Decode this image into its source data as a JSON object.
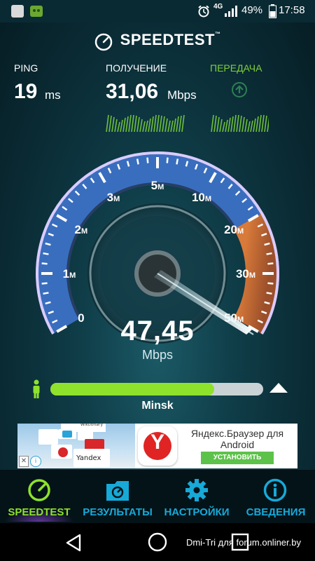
{
  "status_bar": {
    "left_icons": [
      "nfc-icon",
      "android-robot-icon"
    ],
    "right_icons": [
      "alarm-icon",
      "4g-icon",
      "signal-icon",
      "battery-icon"
    ],
    "network": "4G",
    "battery": "49%",
    "time": "17:58"
  },
  "header": {
    "title": "SPEEDTEST",
    "trademark": "™"
  },
  "metrics": {
    "ping": {
      "label": "PING",
      "value": "19",
      "unit": "ms"
    },
    "download": {
      "label": "ПОЛУЧЕНИЕ",
      "value": "31,06",
      "unit": "Mbps"
    },
    "upload": {
      "label": "ПЕРЕДАЧА",
      "active_color": "#7fd03a"
    }
  },
  "gauge": {
    "labels": [
      "0",
      "1",
      "2",
      "3",
      "5",
      "10",
      "20",
      "30",
      "50"
    ],
    "unit_suffix": "M",
    "current": {
      "value": "47,45",
      "unit": "Mbps"
    }
  },
  "progress": {
    "fraction": 0.77
  },
  "server": {
    "name": "Minsk"
  },
  "ad": {
    "title_line1": "Яндекс.Браузер для",
    "title_line2": "Android",
    "button": "УСТАНОВИТЬ",
    "logo_letter": "Y",
    "yandex_label": "Yandex",
    "tile_text": "Wiktionary"
  },
  "bottom_nav": [
    {
      "label": "SPEEDTEST",
      "icon": "speedometer-icon",
      "active": true
    },
    {
      "label": "РЕЗУЛЬТАТЫ",
      "icon": "results-folder-icon",
      "active": false
    },
    {
      "label": "НАСТРОЙКИ",
      "icon": "gear-icon",
      "active": false
    },
    {
      "label": "СВЕДЕНИЯ",
      "icon": "info-icon",
      "active": false
    }
  ],
  "colors": {
    "accent": "#8ee22c",
    "nav_active": "#8ee22c",
    "nav_inactive": "#17a9d8",
    "button_green": "#5cc24a"
  },
  "watermark": "Dmi-Tri для forum.onliner.by"
}
